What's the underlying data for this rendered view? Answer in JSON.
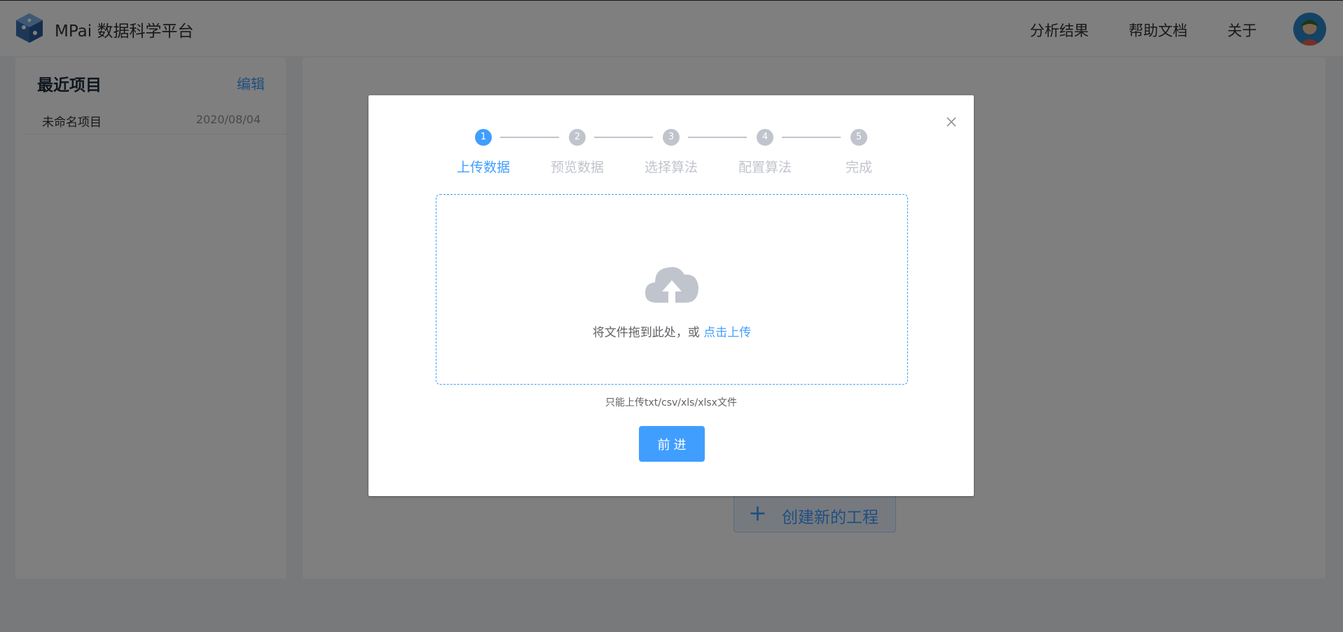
{
  "app": {
    "title": "MPai 数据科学平台"
  },
  "nav": {
    "results": "分析结果",
    "docs": "帮助文档",
    "about": "关于"
  },
  "sidebar": {
    "title": "最近项目",
    "edit": "编辑",
    "projects": [
      {
        "name": "未命名项目",
        "date": "2020/08/04"
      }
    ]
  },
  "main": {
    "create_button": "创建新的工程"
  },
  "dialog": {
    "steps": [
      {
        "number": "1",
        "label": "上传数据",
        "status": "active"
      },
      {
        "number": "2",
        "label": "预览数据",
        "status": "wait"
      },
      {
        "number": "3",
        "label": "选择算法",
        "status": "wait"
      },
      {
        "number": "4",
        "label": "配置算法",
        "status": "wait"
      },
      {
        "number": "5",
        "label": "完成",
        "status": "wait"
      }
    ],
    "upload": {
      "text": "将文件拖到此处，或",
      "link": "点击上传",
      "hint": "只能上传txt/csv/xls/xlsx文件"
    },
    "forward_button": "前 进"
  },
  "colors": {
    "primary": "#409eff",
    "inactive": "#c0c4cc",
    "overlay": "rgba(0,0,0,0.5)"
  },
  "icons": {
    "logo": "cube-logo-icon",
    "close": "close-icon",
    "upload": "cloud-upload-icon",
    "plus": "plus-icon"
  }
}
